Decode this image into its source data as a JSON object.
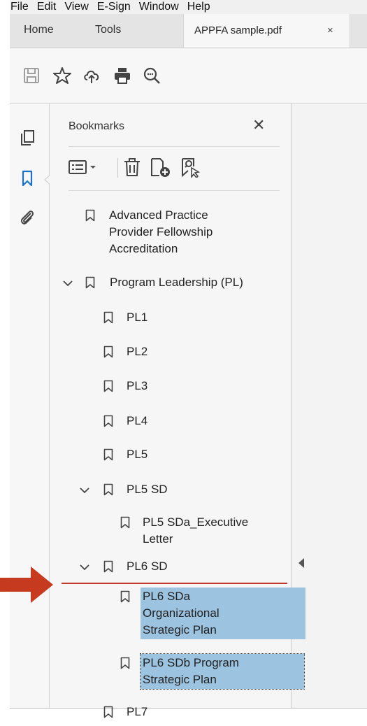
{
  "menu": [
    "File",
    "Edit",
    "View",
    "E-Sign",
    "Window",
    "Help"
  ],
  "tabs": {
    "home": "Home",
    "tools": "Tools",
    "document": "APPFA sample.pdf",
    "close": "×"
  },
  "toolbar_icons": [
    "save-icon",
    "star-icon",
    "cloud-upload-icon",
    "print-icon",
    "zoom-out-icon"
  ],
  "left_rail_icons": [
    "pages-icon",
    "bookmark-icon",
    "attachment-icon"
  ],
  "bookmarks_panel": {
    "title": "Bookmarks",
    "close": "✕",
    "tools": [
      "options-menu-icon",
      "delete-icon",
      "new-bookmark-icon",
      "find-current-bookmark-icon"
    ]
  },
  "bookmarks": [
    {
      "label_lines": [
        "Advanced Practice",
        "Provider Fellowship",
        "Accreditation"
      ],
      "expanded": null,
      "selected": false
    },
    {
      "label_lines": [
        "Program Leadership (PL)"
      ],
      "expanded": true,
      "selected": false
    },
    {
      "label_lines": [
        "PL1"
      ],
      "expanded": null,
      "selected": false
    },
    {
      "label_lines": [
        "PL2"
      ],
      "expanded": null,
      "selected": false
    },
    {
      "label_lines": [
        "PL3"
      ],
      "expanded": null,
      "selected": false
    },
    {
      "label_lines": [
        "PL4"
      ],
      "expanded": null,
      "selected": false
    },
    {
      "label_lines": [
        "PL5"
      ],
      "expanded": null,
      "selected": false
    },
    {
      "label_lines": [
        "PL5 SD"
      ],
      "expanded": true,
      "selected": false
    },
    {
      "label_lines": [
        "PL5 SDa_Executive",
        "Letter"
      ],
      "expanded": null,
      "selected": false
    },
    {
      "label_lines": [
        "PL6 SD"
      ],
      "expanded": true,
      "selected": false
    },
    {
      "label_lines": [
        "PL6 SDa",
        "Organizational",
        "Strategic Plan"
      ],
      "expanded": null,
      "selected": true
    },
    {
      "label_lines": [
        "PL6 SDb Program",
        "Strategic Plan"
      ],
      "expanded": null,
      "selected": true
    },
    {
      "label_lines": [
        "PL7"
      ],
      "expanded": null,
      "selected": false
    }
  ],
  "colors": {
    "selection": "#9cc3e0",
    "accent_blue": "#1a73c8",
    "drop_indicator": "#c0392b"
  }
}
